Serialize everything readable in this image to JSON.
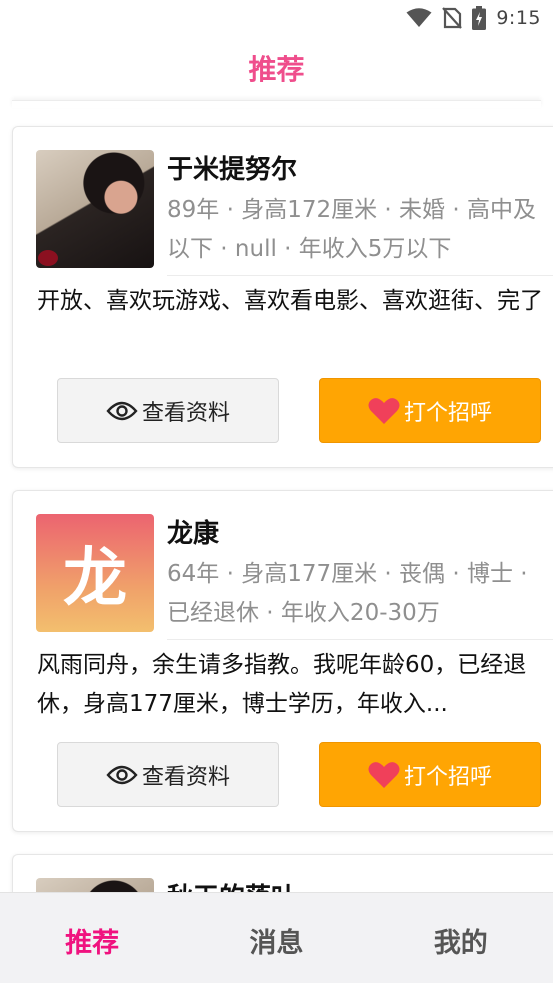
{
  "status_bar": {
    "time": "9:15",
    "icons": [
      "wifi-icon",
      "no-sim-icon",
      "battery-charging-icon"
    ]
  },
  "header": {
    "title": "推荐"
  },
  "profiles": [
    {
      "name": "于米提努尔",
      "meta": "89年 · 身高172厘米 · 未婚 · 高中及以下 · null · 年收入5万以下",
      "bio": "开放、喜欢玩游戏、喜欢看电影、喜欢逛街、完了",
      "avatar_type": "photo",
      "view_label": "查看资料",
      "greet_label": "打个招呼"
    },
    {
      "name": "龙康",
      "meta": "64年 · 身高177厘米 · 丧偶 · 博士 · 已经退休 · 年收入20-30万",
      "bio": "风雨同舟，余生请多指教。我呢年龄60，已经退休，身高177厘米，博士学历，年收入...",
      "avatar_type": "letter",
      "avatar_letter": "龙",
      "view_label": "查看资料",
      "greet_label": "打个招呼"
    },
    {
      "name": "秋天的落叶",
      "avatar_type": "photo"
    }
  ],
  "bottom_nav": {
    "items": [
      {
        "label": "推荐",
        "active": true
      },
      {
        "label": "消息",
        "active": false
      },
      {
        "label": "我的",
        "active": false
      }
    ]
  },
  "colors": {
    "accent_pink": "#ef4e8c",
    "nav_active": "#f0127f",
    "greet_button": "#ffa503",
    "heart": "#f0405a"
  }
}
